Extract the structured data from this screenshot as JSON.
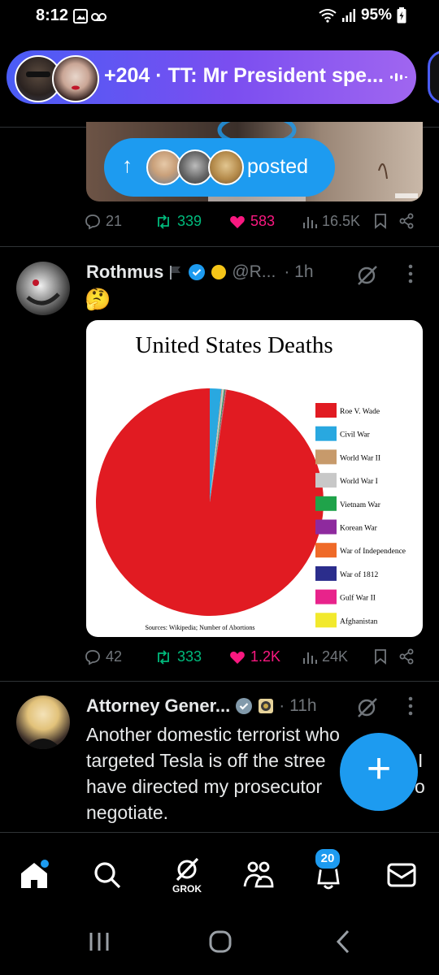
{
  "status_bar": {
    "time": "8:12",
    "battery": "95%"
  },
  "space_banner": {
    "text": "+204 · TT: Mr President spe..."
  },
  "new_posts_pill": {
    "label": "posted",
    "arrow": "↑"
  },
  "prev_tweet": {
    "replies": "21",
    "reposts": "339",
    "likes": "583",
    "views": "16.5K"
  },
  "tweet": {
    "name": "Rothmus",
    "handle": "@R...",
    "time": "· 1h",
    "emoji": "🤔",
    "replies": "42",
    "reposts": "333",
    "likes": "1.2K",
    "views": "24K"
  },
  "tweet2": {
    "name": "Attorney Gener...",
    "time": "· 11h",
    "lines": [
      "Another domestic terrorist who",
      "targeted Tesla is off the stree",
      "have directed my prosecutor",
      "negotiate."
    ],
    "line2_trail": "I",
    "line3_trail": "o"
  },
  "chart_data": {
    "type": "pie",
    "title": "United States Deaths",
    "source": "Sources: Wikipedia; Number of Abortions",
    "legend_position": "right",
    "categories": [
      "Roe V. Wade",
      "Civil War",
      "World War II",
      "World War I",
      "Vietnam War",
      "Korean War",
      "War of Independence",
      "War of 1812",
      "Gulf War II",
      "Afghanistan"
    ],
    "values": [
      97.4,
      1.65,
      0.1,
      0.25,
      0.14,
      0.08,
      0.07,
      0.03,
      0.01,
      0.005
    ],
    "colors": [
      "#e11b22",
      "#29a8e0",
      "#c79a6b",
      "#c8c8c8",
      "#1fa34a",
      "#8e2a9e",
      "#ef6a28",
      "#2b2d8c",
      "#e8238b",
      "#f2e92d"
    ]
  },
  "fab": {
    "label": "+"
  },
  "bottom_nav": {
    "grok_label": "GROK",
    "notifications_badge": "20"
  }
}
